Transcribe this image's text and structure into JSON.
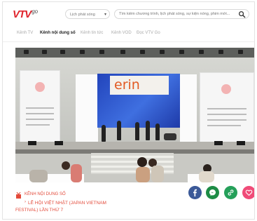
{
  "brand": {
    "logo_text": "VTV",
    "logo_suffix": "go",
    "color": "#e0262e"
  },
  "header": {
    "schedule_label": "Lịch phát sóng",
    "search_placeholder": "Tìm kiếm chương trình, lịch phát sóng, sự kiện nóng, phim mới..."
  },
  "nav": {
    "items": [
      {
        "label": "Kênh TV",
        "active": false
      },
      {
        "label": "Kênh nội dung số",
        "active": true
      },
      {
        "label": "Kênh tin tức",
        "active": false
      },
      {
        "label": "Kênh VOD",
        "active": false
      },
      {
        "label": "Đọc VTV Go",
        "active": false
      }
    ]
  },
  "video": {
    "screen_text": "erin",
    "icon": "live-stage-video"
  },
  "caption": {
    "channel": "KÊNH NỘI DUNG SỐ",
    "title_line1": "LỄ HỘI VIỆT NHẬT (JAPAN VIETNAM",
    "title_line2": "FESTIVAL) LẦN THỨ 7",
    "color": "#e34a3a"
  },
  "share": {
    "items": [
      {
        "icon": "facebook-icon",
        "color": "#3b5998"
      },
      {
        "icon": "messenger-icon",
        "color": "#1d8c45"
      },
      {
        "icon": "link-icon",
        "color": "#25a05a"
      },
      {
        "icon": "heart-icon",
        "color": "#f04b78"
      }
    ]
  }
}
